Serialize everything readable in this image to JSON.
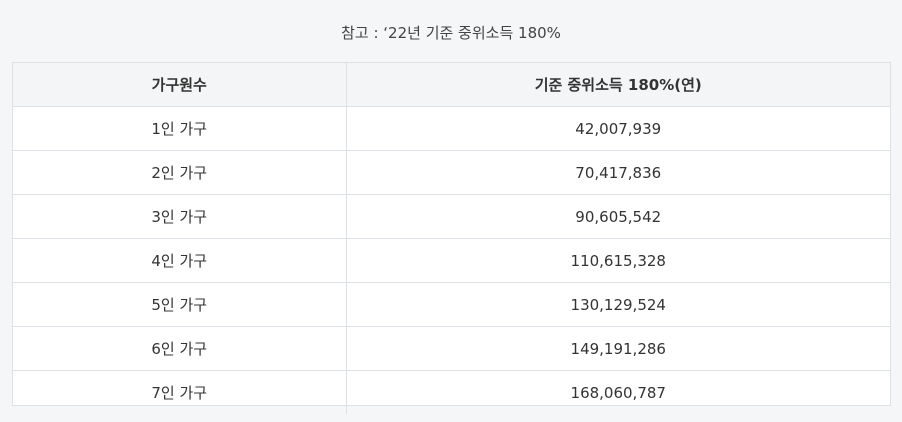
{
  "caption": "참고 : ‘22년 기준 중위소득 180%",
  "table": {
    "headers": [
      "가구원수",
      "기준 중위소득 180%(연)"
    ],
    "rows": [
      [
        "1인 가구",
        "42,007,939"
      ],
      [
        "2인 가구",
        "70,417,836"
      ],
      [
        "3인 가구",
        "90,605,542"
      ],
      [
        "4인 가구",
        "110,615,328"
      ],
      [
        "5인 가구",
        "130,129,524"
      ],
      [
        "6인 가구",
        "149,191,286"
      ],
      [
        "7인 가구",
        "168,060,787"
      ]
    ]
  },
  "colors": {
    "header_bg": "#f4f5f7",
    "border": "#dde0e4",
    "page_bg": "#f5f6f8"
  }
}
